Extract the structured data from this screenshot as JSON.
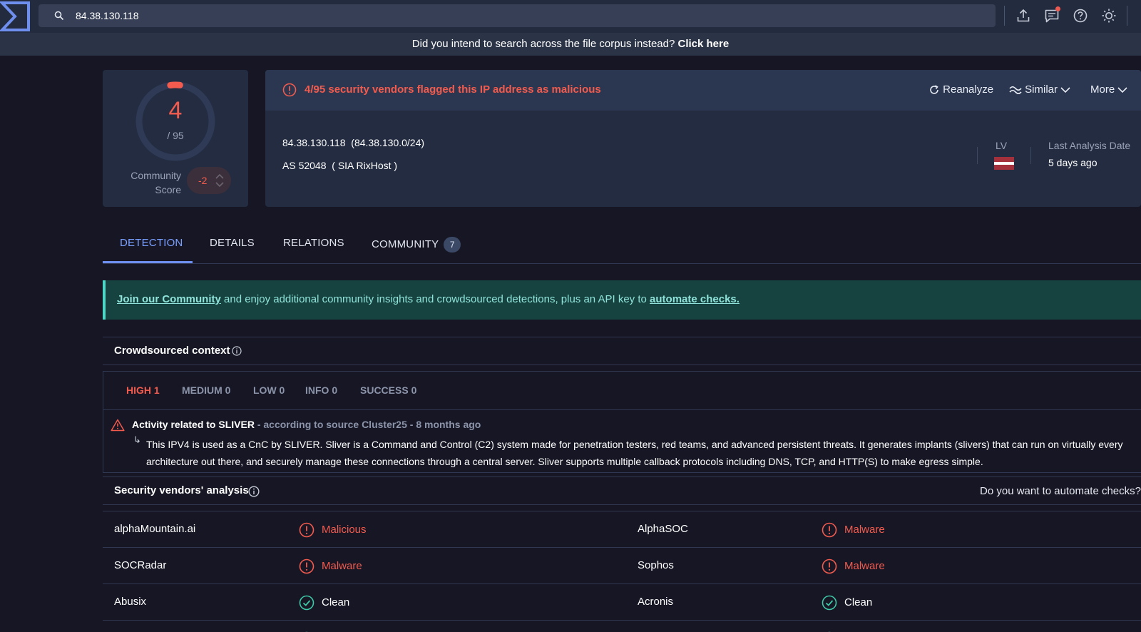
{
  "search": {
    "value": "84.38.130.118"
  },
  "banner": {
    "text": "Did you intend to search across the file corpus instead?",
    "link": "Click here"
  },
  "score": {
    "detections": "4",
    "total": "/ 95",
    "community_label": "Community Score",
    "community_value": "-2"
  },
  "alert": {
    "text": "4/95 security vendors flagged this IP address as malicious"
  },
  "actions": {
    "reanalyze": "Reanalyze",
    "similar": "Similar",
    "more": "More"
  },
  "ip_info": {
    "ip": "84.38.130.118",
    "network": "(84.38.130.0/24)",
    "as": "AS 52048",
    "owner": "( SIA RixHost )",
    "country": "LV",
    "last_analysis_label": "Last Analysis Date",
    "last_analysis_value": "5 days ago"
  },
  "tabs": {
    "detection": "DETECTION",
    "details": "DETAILS",
    "relations": "RELATIONS",
    "community": "COMMUNITY",
    "community_count": "7"
  },
  "callout": {
    "link1": "Join our Community",
    "middle": " and enjoy additional community insights and crowdsourced detections, plus an API key to ",
    "link2": "automate checks."
  },
  "crowdsourced": {
    "title": "Crowdsourced context",
    "severity": {
      "high": "HIGH 1",
      "medium": "MEDIUM 0",
      "low": "LOW 0",
      "info": "INFO 0",
      "success": "SUCCESS 0"
    },
    "entry_title": "Activity related to SLIVER",
    "entry_meta": " - according to source Cluster25 - 8 months ago",
    "arrow": "↳",
    "entry_description": "This IPV4 is used as a CnC by SLIVER. Sliver is a Command and Control (C2) system made for penetration testers, red teams, and advanced persistent threats. It generates implants (slivers) that can run on virtually every architecture out there, and securely manage these connections through a central server. Sliver supports multiple callback protocols including DNS, TCP, and HTTP(S) to make egress simple."
  },
  "vendors": {
    "title": "Security vendors' analysis",
    "automate_prompt": "Do you want to automate checks?",
    "rows": [
      {
        "left_name": "alphaMountain.ai",
        "left_result": "Malicious",
        "right_name": "AlphaSOC",
        "right_result": "Malware"
      },
      {
        "left_name": "SOCRadar",
        "left_result": "Malware",
        "right_name": "Sophos",
        "right_result": "Malware"
      },
      {
        "left_name": "Abusix",
        "left_result": "Clean",
        "right_name": "Acronis",
        "right_result": "Clean"
      }
    ]
  },
  "colors": {
    "malicious": "#f25b4e",
    "clean": "#3ec9a7",
    "accent": "#7aa0ff",
    "background": "#161624",
    "card": "#232c40"
  }
}
